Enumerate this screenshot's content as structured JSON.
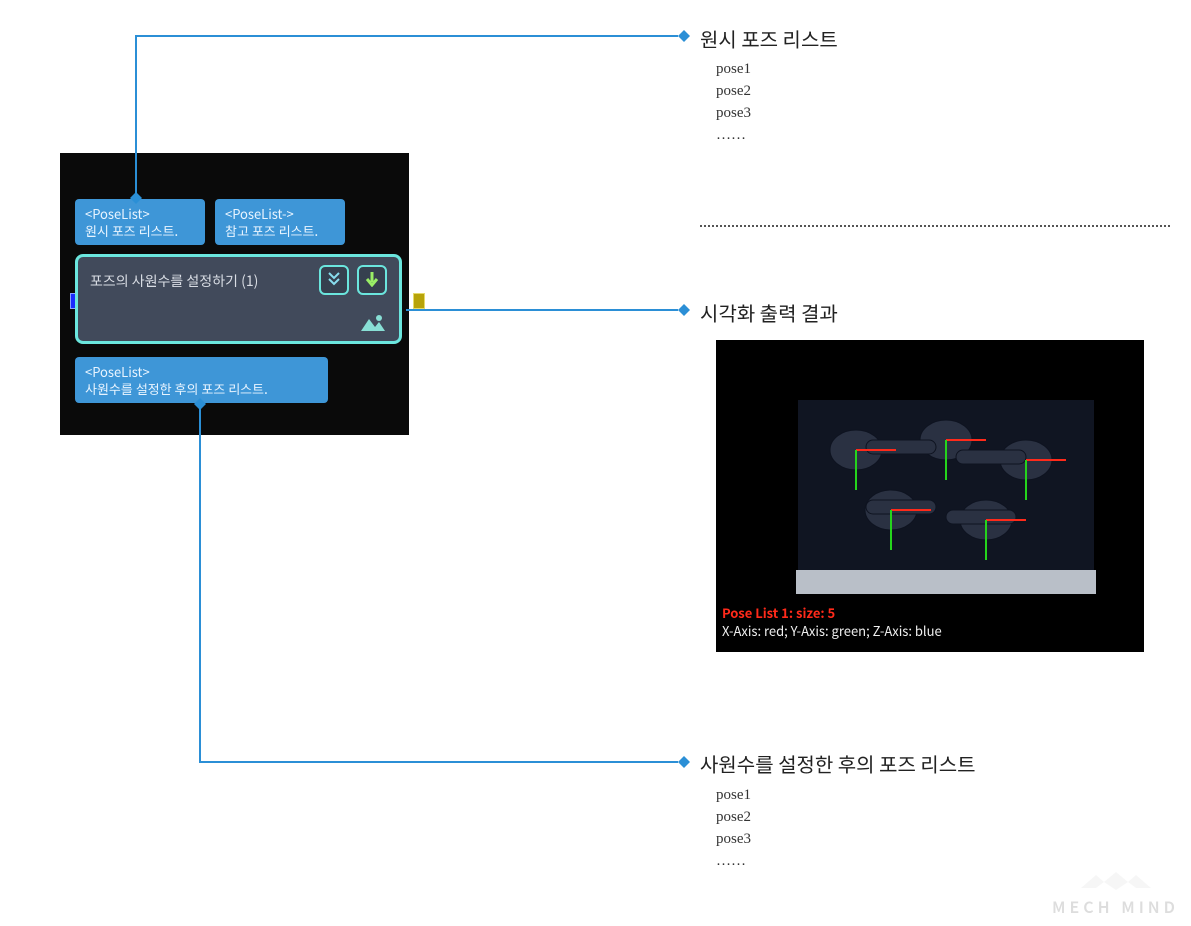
{
  "node": {
    "input1": {
      "type": "<PoseList>",
      "label": "원시 포즈 리스트."
    },
    "input2": {
      "type": "<PoseList->",
      "label": "참고 포즈 리스트."
    },
    "title": "포즈의 사원수를 설정하기 (1)",
    "output": {
      "type": "<PoseList>",
      "label": "사원수를 설정한 후의 포즈 리스트."
    },
    "icons": {
      "collapse": "double-chevron-down-icon",
      "run": "arrow-down-icon",
      "viz": "eye-image-icon"
    }
  },
  "sections": {
    "raw": {
      "title": "원시 포즈 리스트",
      "lines": [
        "pose1",
        "pose2",
        "pose3",
        "……"
      ]
    },
    "viz": {
      "title": "시각화 출력 결과",
      "overlay_size": "Pose List 1: size: 5",
      "overlay_axes": "X-Axis: red; Y-Axis: green; Z-Axis: blue"
    },
    "out": {
      "title": "사원수를 설정한 후의 포즈 리스트",
      "lines": [
        "pose1",
        "pose2",
        "pose3",
        "……"
      ]
    }
  },
  "watermark": "MECH MIND"
}
